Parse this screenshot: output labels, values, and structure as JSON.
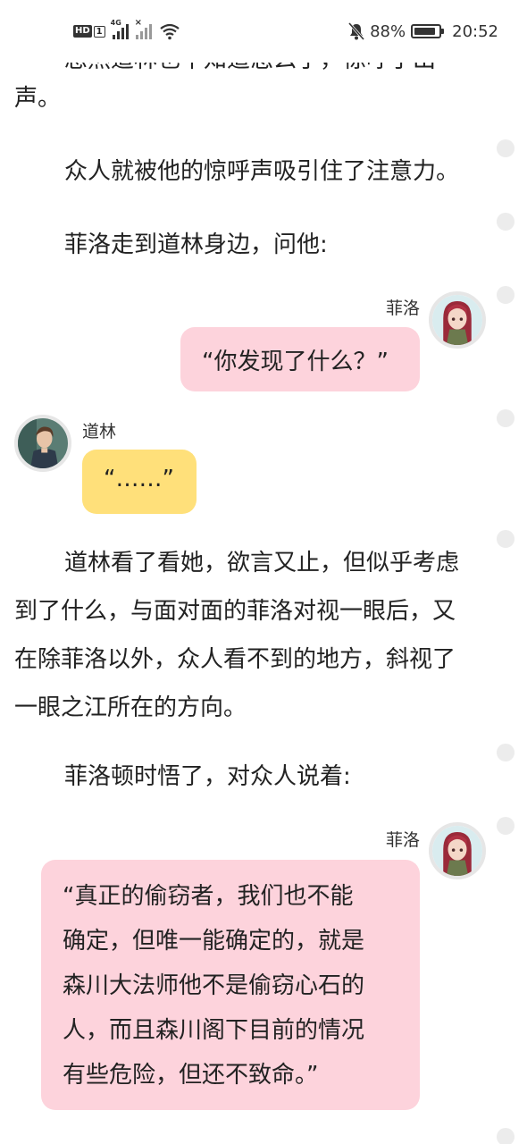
{
  "status_bar": {
    "hd_label": "HD",
    "sim_label": "1",
    "network_label": "4G",
    "battery_percent": "88%",
    "battery_level": 0.88,
    "time": "20:52"
  },
  "content": {
    "clipped_top_text": "忽然道林也不知道怎么了，惊呼了出",
    "para0_end": "声。",
    "para1": "众人就被他的惊呼声吸引住了注意力。",
    "para2": "菲洛走到道林身边，问他:",
    "msg1": {
      "name": "菲洛",
      "text": "“你发现了什么？”"
    },
    "msg2": {
      "name": "道林",
      "text": "“……”"
    },
    "para3_lines": [
      "道林看了看她，欲言又止，但似乎考虑",
      "到了什么，与面对面的菲洛对视一眼后，又",
      "在除菲洛以外，众人看不到的地方，斜视了",
      "一眼之江所在的方向。"
    ],
    "para4": "菲洛顿时悟了，对众人说着:",
    "msg3": {
      "name": "菲洛",
      "lines": [
        "“真正的偷窃者，我们也不能",
        "确定，但唯一能确定的，就是",
        "森川大法师他不是偷窃心石的",
        "人，而且森川阁下目前的情况",
        "有些危险，但还不致命。”"
      ]
    }
  },
  "colors": {
    "pink_bubble": "#fdd3dc",
    "yellow_bubble": "#ffe07a",
    "side_dot": "#ececec"
  }
}
